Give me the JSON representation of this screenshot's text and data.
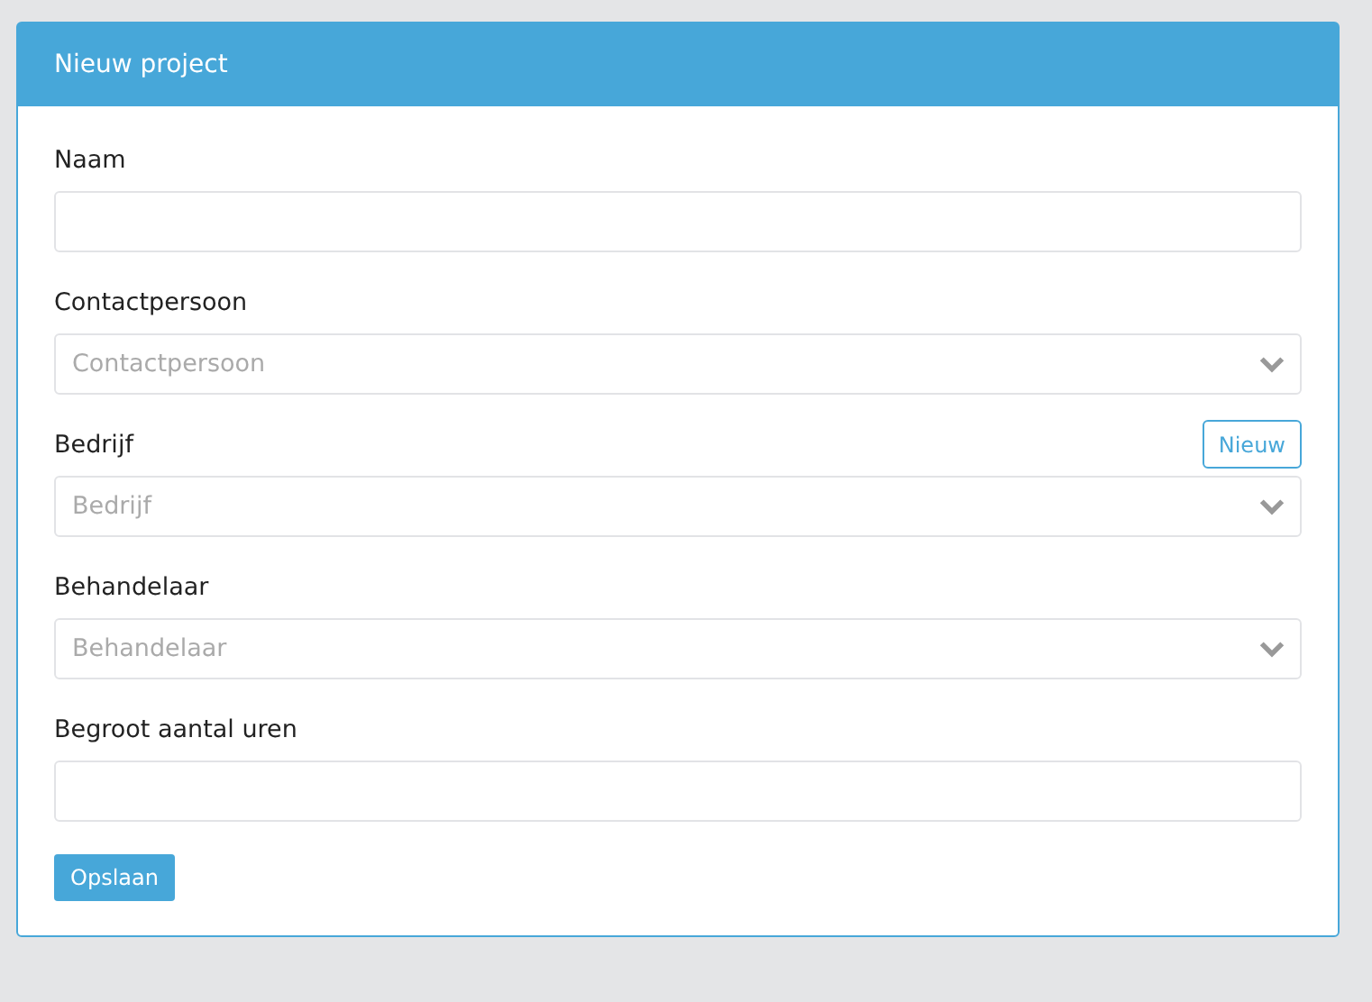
{
  "panel": {
    "title": "Nieuw project"
  },
  "fields": [
    {
      "label": "Naam",
      "kind": "text"
    },
    {
      "label": "Contactpersoon",
      "kind": "select",
      "placeholder": "Contactpersoon"
    },
    {
      "label": "Bedrijf",
      "kind": "select",
      "placeholder": "Bedrijf",
      "action": "Nieuw"
    },
    {
      "label": "Behandelaar",
      "kind": "select",
      "placeholder": "Behandelaar"
    },
    {
      "label": "Begroot aantal uren",
      "kind": "text"
    }
  ],
  "submit": "Opslaan"
}
